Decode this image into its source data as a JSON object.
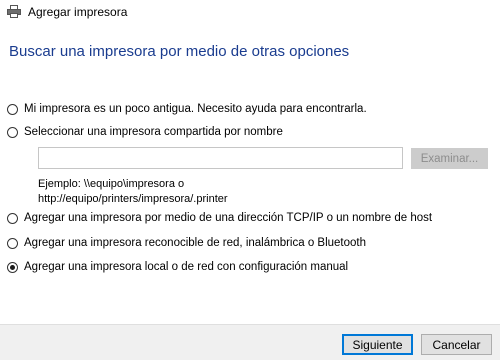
{
  "window": {
    "title": "Agregar impresora",
    "icon": "printer-icon"
  },
  "heading": "Buscar una impresora por medio de otras opciones",
  "options": [
    {
      "label": "Mi impresora es un poco antigua. Necesito ayuda para encontrarla.",
      "checked": false
    },
    {
      "label": "Seleccionar una impresora compartida por nombre",
      "checked": false
    },
    {
      "label": "Agregar una impresora por medio de una dirección TCP/IP o un nombre de host",
      "checked": false
    },
    {
      "label": "Agregar una impresora reconocible de red, inalámbrica o Bluetooth",
      "checked": false
    },
    {
      "label": "Agregar una impresora local o de red con configuración manual",
      "checked": true
    }
  ],
  "shared_printer": {
    "value": "",
    "browse_label": "Examinar...",
    "example_line1": "Ejemplo: \\\\equipo\\impresora o",
    "example_line2": "http://equipo/printers/impresora/.printer"
  },
  "footer": {
    "next_label": "Siguiente",
    "cancel_label": "Cancelar"
  }
}
